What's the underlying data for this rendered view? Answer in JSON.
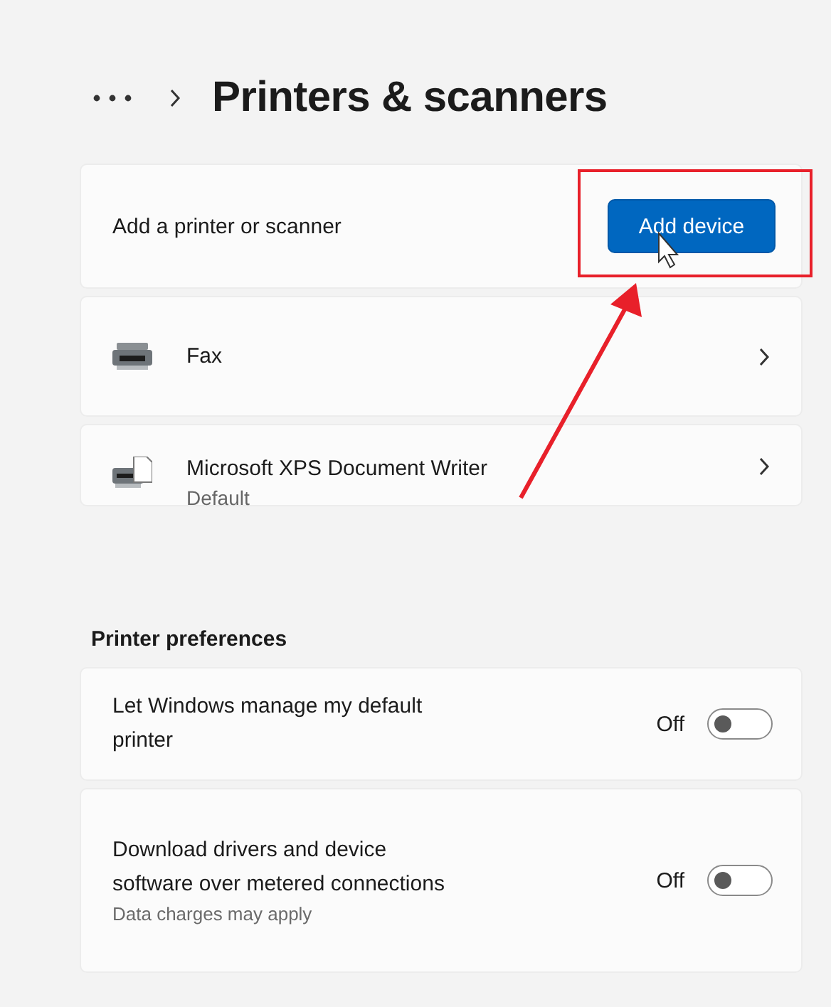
{
  "breadcrumb": {
    "title": "Printers & scanners"
  },
  "add_card": {
    "label": "Add a printer or scanner",
    "button": "Add device"
  },
  "devices": [
    {
      "name": "Fax",
      "kind": "fax"
    },
    {
      "name": "Microsoft XPS Document Writer",
      "subtitle": "Default",
      "kind": "writer"
    }
  ],
  "section_title": "Printer preferences",
  "preferences": [
    {
      "label": "Let Windows manage my default printer",
      "state": "Off",
      "on": false
    },
    {
      "label": "Download drivers and device software over metered connections",
      "note": "Data charges may apply",
      "state": "Off",
      "on": false
    }
  ]
}
